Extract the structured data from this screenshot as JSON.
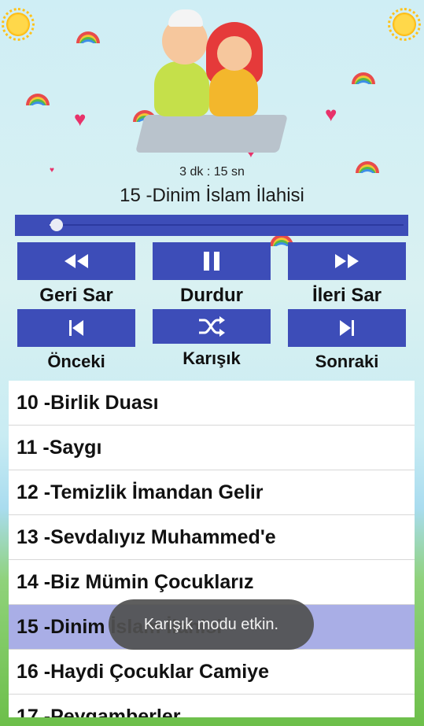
{
  "player": {
    "duration": "3 dk : 15 sn",
    "now_playing": "15 -Dinim İslam İlahisi",
    "progress": 0.02
  },
  "controls": {
    "rewind_label": "Geri Sar",
    "pause_label": "Durdur",
    "forward_label": "İleri Sar",
    "previous_label": "Önceki",
    "shuffle_label": "Karışık",
    "next_label": "Sonraki"
  },
  "playlist": {
    "items": [
      {
        "label": "10 -Birlik Duası",
        "active": false
      },
      {
        "label": "11 -Saygı",
        "active": false
      },
      {
        "label": "12 -Temizlik İmandan Gelir",
        "active": false
      },
      {
        "label": "13 -Sevdalıyız Muhammed'e",
        "active": false
      },
      {
        "label": "14 -Biz Mümin Çocuklarız",
        "active": false
      },
      {
        "label": "15 -Dinim İslam İlahisi",
        "active": true
      },
      {
        "label": "16 -Haydi Çocuklar Camiye",
        "active": false
      },
      {
        "label": "17 -Peygamberler",
        "active": false
      }
    ]
  },
  "toast": {
    "message": "Karışık modu etkin."
  },
  "colors": {
    "button_bg": "#3d4db8",
    "active_row": "#a9aee6",
    "heart": "#e8326a"
  },
  "icons": [
    "rewind-icon",
    "pause-icon",
    "fast-forward-icon",
    "skip-previous-icon",
    "shuffle-icon",
    "skip-next-icon"
  ]
}
